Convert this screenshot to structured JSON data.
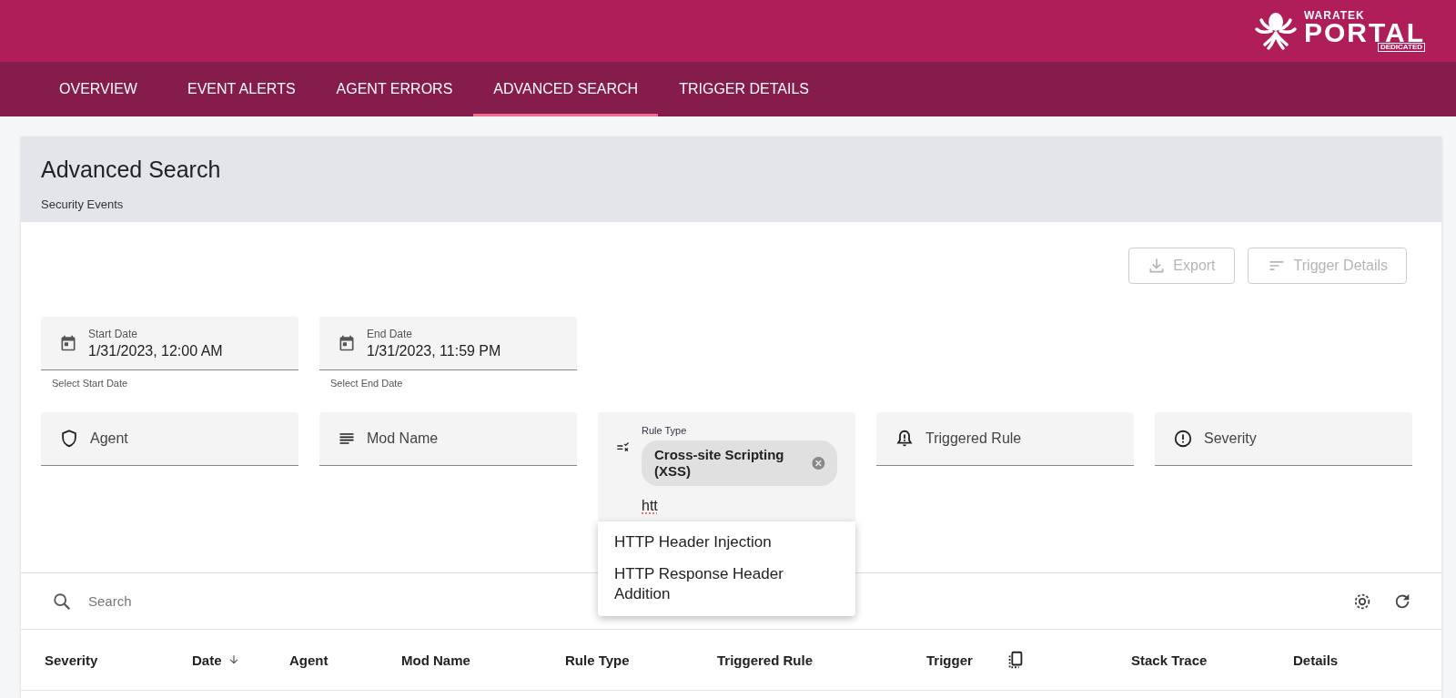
{
  "logo": {
    "brand": "WARATEK",
    "product": "PORTAL",
    "edition": "DEDICATED"
  },
  "tabs": [
    {
      "label": "OVERVIEW",
      "selected": false
    },
    {
      "label": "EVENT ALERTS",
      "selected": false
    },
    {
      "label": "AGENT ERRORS",
      "selected": false
    },
    {
      "label": "ADVANCED SEARCH",
      "selected": true
    },
    {
      "label": "TRIGGER DETAILS",
      "selected": false
    }
  ],
  "page": {
    "title": "Advanced Search",
    "subtitle": "Security Events"
  },
  "actions": [
    {
      "label": "Export",
      "disabled": true
    },
    {
      "label": "Trigger Details",
      "disabled": true
    }
  ],
  "date_fields": [
    {
      "label": "Start Date",
      "value": "1/31/2023, 12:00 AM",
      "helper": "Select Start Date"
    },
    {
      "label": "End Date",
      "value": "1/31/2023, 11:59 PM",
      "helper": "Select End Date"
    }
  ],
  "filters": [
    {
      "kind": "text",
      "label": "Agent"
    },
    {
      "kind": "text",
      "label": "Mod Name"
    },
    {
      "kind": "chips",
      "label": "Rule Type",
      "chips": [
        "Cross-site Scripting (XSS)"
      ],
      "value": "htt",
      "focused": true,
      "options": [
        "HTTP Header Injection",
        "HTTP Response Header Addition"
      ]
    },
    {
      "kind": "text",
      "label": "Triggered Rule"
    },
    {
      "kind": "text",
      "label": "Severity"
    }
  ],
  "search": {
    "placeholder": "Search"
  },
  "table": {
    "columns": [
      {
        "label": "Severity",
        "sorted": false
      },
      {
        "label": "Date",
        "sorted": true
      },
      {
        "label": "Agent",
        "sorted": false
      },
      {
        "label": "Mod Name",
        "sorted": false
      },
      {
        "label": "Rule Type",
        "sorted": false
      },
      {
        "label": "Triggered Rule",
        "sorted": false
      },
      {
        "label": "Trigger",
        "sorted": false
      },
      {
        "label": "Stack Trace",
        "sorted": false
      },
      {
        "label": "Details",
        "sorted": false
      }
    ]
  }
}
